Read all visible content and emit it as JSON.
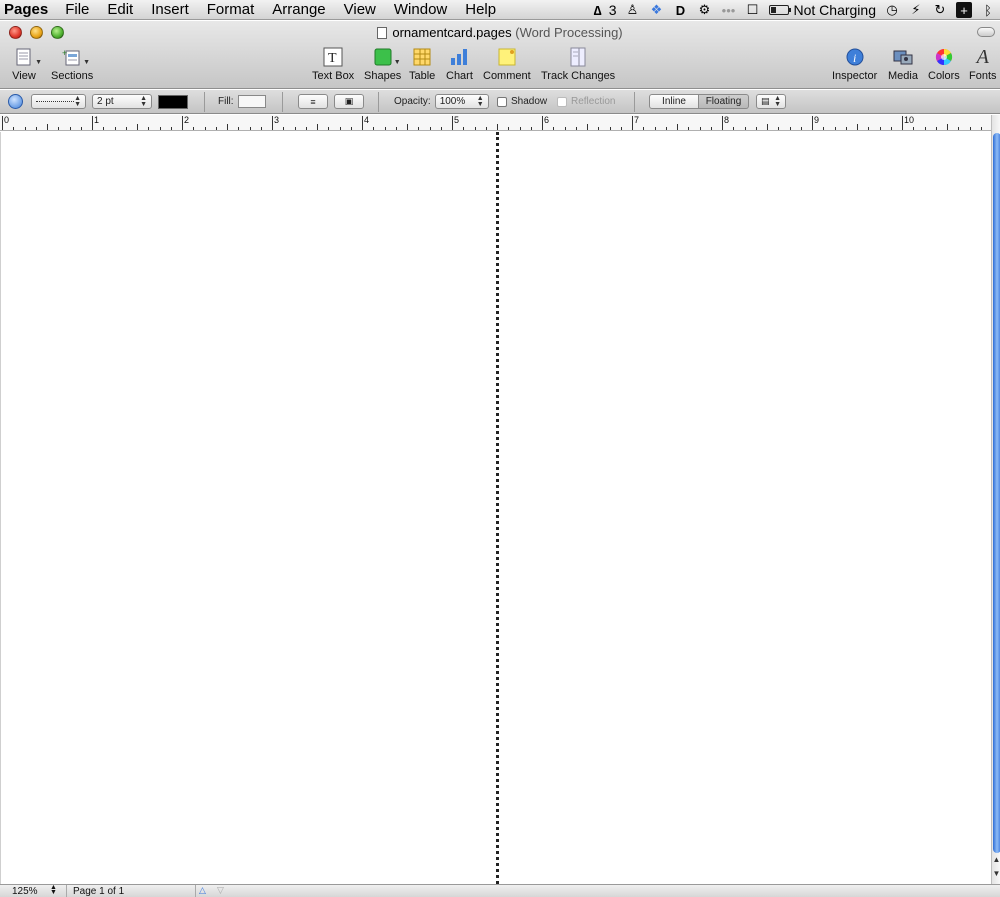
{
  "menubar": {
    "app": "Pages",
    "menus": [
      "File",
      "Edit",
      "Insert",
      "Format",
      "Arrange",
      "View",
      "Window",
      "Help"
    ],
    "adobe_count": "3",
    "battery_status": "Not Charging"
  },
  "window": {
    "filename": "ornamentcard.pages",
    "doc_type": "(Word Processing)"
  },
  "toolbar": {
    "view": "View",
    "sections": "Sections",
    "text_box": "Text Box",
    "shapes": "Shapes",
    "table": "Table",
    "chart": "Chart",
    "comment": "Comment",
    "track_changes": "Track Changes",
    "inspector": "Inspector",
    "media": "Media",
    "colors": "Colors",
    "fonts": "Fonts"
  },
  "formatbar": {
    "stroke_width": "2 pt",
    "stroke_color": "#000000",
    "fill_label": "Fill:",
    "opacity_label": "Opacity:",
    "opacity_value": "100%",
    "shadow_label": "Shadow",
    "reflection_label": "Reflection",
    "inline_label": "Inline",
    "floating_label": "Floating"
  },
  "ruler": {
    "numbers": [
      "0",
      "1",
      "2",
      "3",
      "4",
      "5",
      "6",
      "7",
      "8",
      "9",
      "10"
    ]
  },
  "statusbar": {
    "zoom": "125%",
    "page_info": "Page 1 of 1"
  },
  "colors": {
    "scroll_thumb": "#3a78de",
    "fold_line": "#222222"
  }
}
